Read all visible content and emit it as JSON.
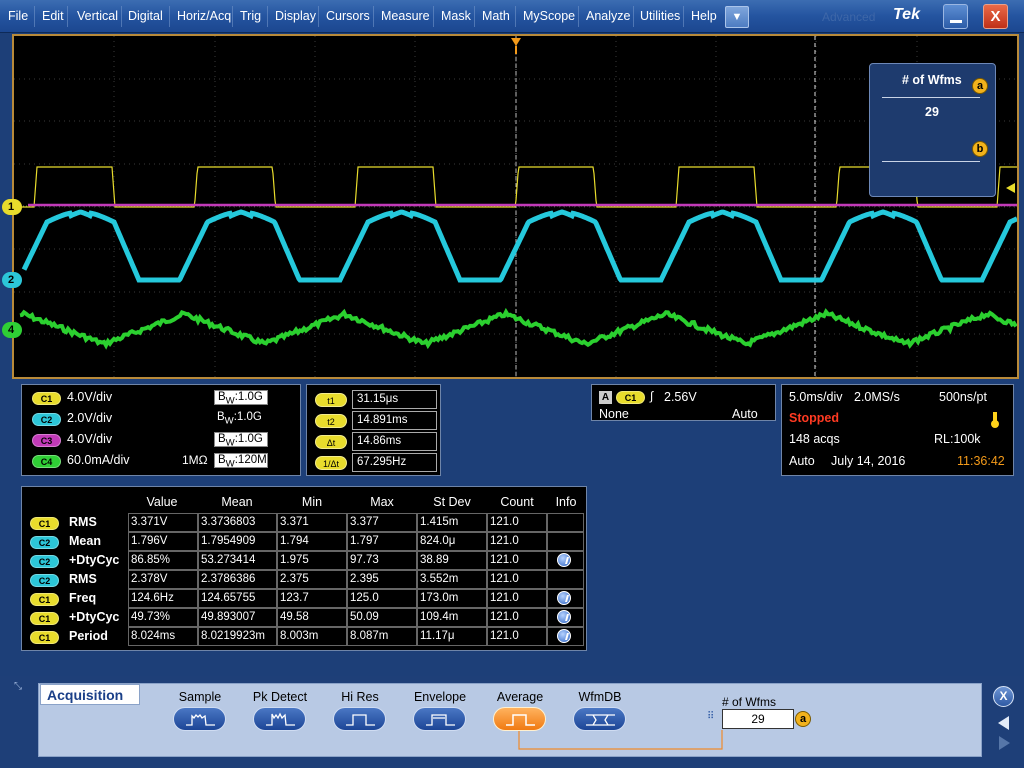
{
  "menu": {
    "items": [
      "File",
      "Edit",
      "Vertical",
      "Digital",
      "Horiz/Acq",
      "Trig",
      "Display",
      "Cursors",
      "Measure",
      "Mask",
      "Math",
      "MyScope",
      "Analyze",
      "Utilities",
      "Help"
    ],
    "dropdown_icon": "chevron-down-icon",
    "ghost_text": "Advanced",
    "logo": "Tek",
    "close_label": "X"
  },
  "waveform_overlay": {
    "title": "# of Wfms",
    "value": "29",
    "badge_a": "a",
    "badge_b": "b"
  },
  "channel_markers": [
    "1",
    "2",
    "4"
  ],
  "channels": [
    {
      "chip": "C1",
      "scale": "4.0V/div",
      "impedance": "",
      "bw": "1.0G",
      "color": "#e8dc2c",
      "bw_boxed": true
    },
    {
      "chip": "C2",
      "scale": "2.0V/div",
      "impedance": "",
      "bw": "1.0G",
      "color": "#2cc6d8",
      "bw_boxed": false
    },
    {
      "chip": "C3",
      "scale": "4.0V/div",
      "impedance": "",
      "bw": "1.0G",
      "color": "#c23ab8",
      "bw_boxed": true
    },
    {
      "chip": "C4",
      "scale": "60.0mA/div",
      "impedance": "1MΩ",
      "bw": "120M",
      "color": "#2fce35",
      "bw_boxed": true
    }
  ],
  "bw_prefix_b": "B",
  "bw_prefix_w": "W",
  "cursors": [
    {
      "chip": "t1",
      "value": "31.15μs"
    },
    {
      "chip": "t2",
      "value": "14.891ms"
    },
    {
      "chip": "Δt",
      "value": "14.86ms"
    },
    {
      "chip": "1/Δt",
      "value": "67.295Hz"
    }
  ],
  "trigger": {
    "type": "A",
    "source": "C1",
    "level": "2.56V",
    "coupling": "None",
    "mode": "Auto"
  },
  "horizontal": {
    "scale": "5.0ms/div",
    "sample_rate": "2.0MS/s",
    "resolution": "500ns/pt",
    "state": "Stopped",
    "acqs": "148 acqs",
    "record_length": "RL:100k",
    "run_mode": "Auto",
    "date": "July 14, 2016",
    "time": "11:36:42"
  },
  "measurements": {
    "headers": [
      "Value",
      "Mean",
      "Min",
      "Max",
      "St Dev",
      "Count",
      "Info"
    ],
    "rows": [
      {
        "chip": "C1",
        "name": "RMS",
        "value": "3.371V",
        "mean": "3.3736803",
        "min": "3.371",
        "max": "3.377",
        "stdev": "1.415m",
        "count": "121.0",
        "info": false
      },
      {
        "chip": "C2",
        "name": "Mean",
        "value": "1.796V",
        "mean": "1.7954909",
        "min": "1.794",
        "max": "1.797",
        "stdev": "824.0μ",
        "count": "121.0",
        "info": false
      },
      {
        "chip": "C2",
        "name": "+DtyCyc",
        "value": "86.85%",
        "mean": "53.273414",
        "min": "1.975",
        "max": "97.73",
        "stdev": "38.89",
        "count": "121.0",
        "info": true
      },
      {
        "chip": "C2",
        "name": "RMS",
        "value": "2.378V",
        "mean": "2.3786386",
        "min": "2.375",
        "max": "2.395",
        "stdev": "3.552m",
        "count": "121.0",
        "info": false
      },
      {
        "chip": "C1",
        "name": "Freq",
        "value": "124.6Hz",
        "mean": "124.65755",
        "min": "123.7",
        "max": "125.0",
        "stdev": "173.0m",
        "count": "121.0",
        "info": true
      },
      {
        "chip": "C1",
        "name": "+DtyCyc",
        "value": "49.73%",
        "mean": "49.893007",
        "min": "49.58",
        "max": "50.09",
        "stdev": "109.4m",
        "count": "121.0",
        "info": true
      },
      {
        "chip": "C1",
        "name": "Period",
        "value": "8.024ms",
        "mean": "8.0219923m",
        "min": "8.003m",
        "max": "8.087m",
        "stdev": "11.17μ",
        "count": "121.0",
        "info": true
      }
    ]
  },
  "acquisition": {
    "title": "Acquisition",
    "modes": [
      "Sample",
      "Pk Detect",
      "Hi Res",
      "Envelope",
      "Average",
      "WfmDB"
    ],
    "active_mode": "Average",
    "wfms_label": "# of Wfms",
    "wfms_value": "29",
    "wfms_badge": "a",
    "close_label": "X"
  }
}
